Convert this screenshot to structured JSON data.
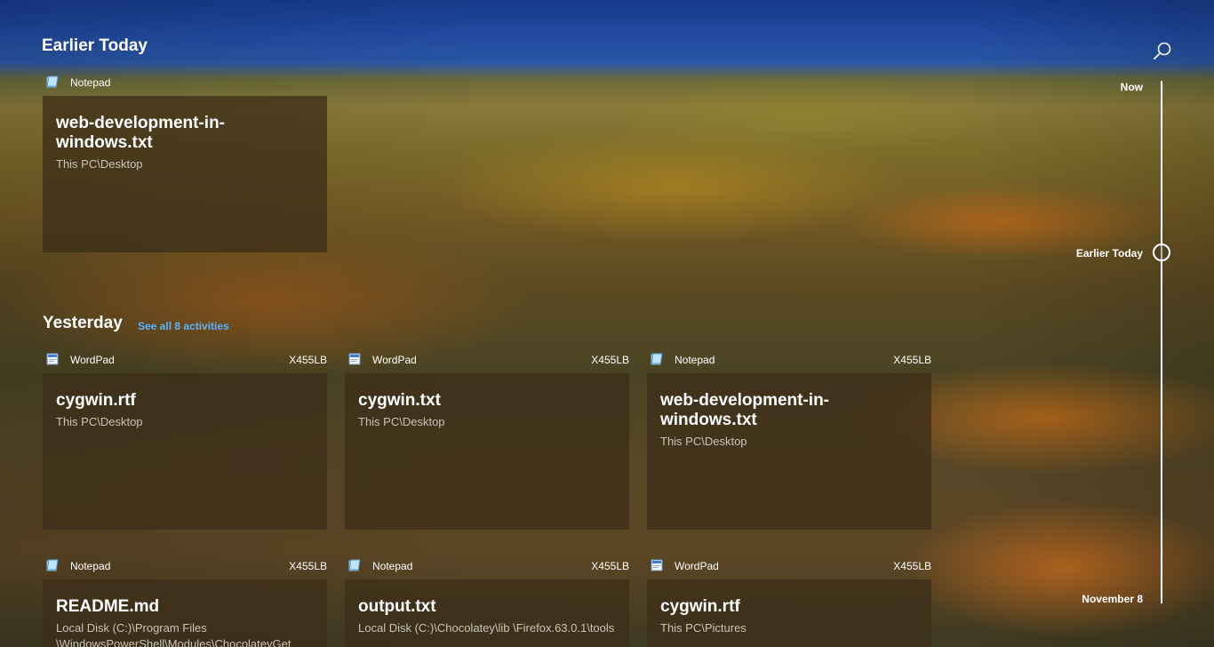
{
  "sections": {
    "earlier_today": {
      "title": "Earlier Today"
    },
    "yesterday": {
      "title": "Yesterday",
      "see_all": "See all 8 activities"
    }
  },
  "cards": [
    {
      "app": "Notepad",
      "app_icon": "notepad-icon",
      "device": "",
      "title": "web-development-in-windows.txt",
      "path": "This PC\\Desktop"
    },
    {
      "app": "WordPad",
      "app_icon": "wordpad-icon",
      "device": "X455LB",
      "title": "cygwin.rtf",
      "path": "This PC\\Desktop"
    },
    {
      "app": "WordPad",
      "app_icon": "wordpad-icon",
      "device": "X455LB",
      "title": "cygwin.txt",
      "path": "This PC\\Desktop"
    },
    {
      "app": "Notepad",
      "app_icon": "notepad-icon",
      "device": "X455LB",
      "title": "web-development-in-windows.txt",
      "path": "This PC\\Desktop"
    },
    {
      "app": "Notepad",
      "app_icon": "notepad-icon",
      "device": "X455LB",
      "title": "README.md",
      "path": "Local Disk (C:)\\Program Files \\WindowsPowerShell\\Modules\\ChocolateyGet"
    },
    {
      "app": "Notepad",
      "app_icon": "notepad-icon",
      "device": "X455LB",
      "title": "output.txt",
      "path": "Local Disk (C:)\\Chocolatey\\lib \\Firefox.63.0.1\\tools"
    },
    {
      "app": "WordPad",
      "app_icon": "wordpad-icon",
      "device": "X455LB",
      "title": "cygwin.rtf",
      "path": "This PC\\Pictures"
    }
  ],
  "timeline": {
    "now": "Now",
    "earlier_today": "Earlier Today",
    "november": "November 8"
  },
  "colors": {
    "link": "#59b4ff",
    "card_bg": "#3e2e18",
    "text_secondary": "#c9c4b8"
  }
}
